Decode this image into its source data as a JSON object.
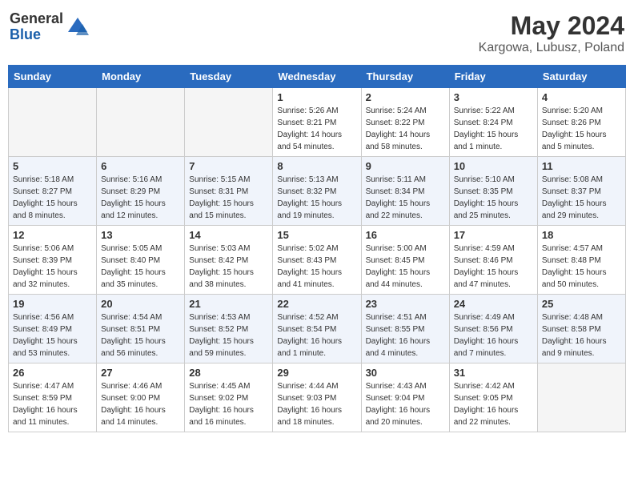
{
  "logo": {
    "general": "General",
    "blue": "Blue"
  },
  "header": {
    "title": "May 2024",
    "subtitle": "Kargowa, Lubusz, Poland"
  },
  "weekdays": [
    "Sunday",
    "Monday",
    "Tuesday",
    "Wednesday",
    "Thursday",
    "Friday",
    "Saturday"
  ],
  "weeks": [
    [
      {
        "day": "",
        "info": ""
      },
      {
        "day": "",
        "info": ""
      },
      {
        "day": "",
        "info": ""
      },
      {
        "day": "1",
        "info": "Sunrise: 5:26 AM\nSunset: 8:21 PM\nDaylight: 14 hours\nand 54 minutes."
      },
      {
        "day": "2",
        "info": "Sunrise: 5:24 AM\nSunset: 8:22 PM\nDaylight: 14 hours\nand 58 minutes."
      },
      {
        "day": "3",
        "info": "Sunrise: 5:22 AM\nSunset: 8:24 PM\nDaylight: 15 hours\nand 1 minute."
      },
      {
        "day": "4",
        "info": "Sunrise: 5:20 AM\nSunset: 8:26 PM\nDaylight: 15 hours\nand 5 minutes."
      }
    ],
    [
      {
        "day": "5",
        "info": "Sunrise: 5:18 AM\nSunset: 8:27 PM\nDaylight: 15 hours\nand 8 minutes."
      },
      {
        "day": "6",
        "info": "Sunrise: 5:16 AM\nSunset: 8:29 PM\nDaylight: 15 hours\nand 12 minutes."
      },
      {
        "day": "7",
        "info": "Sunrise: 5:15 AM\nSunset: 8:31 PM\nDaylight: 15 hours\nand 15 minutes."
      },
      {
        "day": "8",
        "info": "Sunrise: 5:13 AM\nSunset: 8:32 PM\nDaylight: 15 hours\nand 19 minutes."
      },
      {
        "day": "9",
        "info": "Sunrise: 5:11 AM\nSunset: 8:34 PM\nDaylight: 15 hours\nand 22 minutes."
      },
      {
        "day": "10",
        "info": "Sunrise: 5:10 AM\nSunset: 8:35 PM\nDaylight: 15 hours\nand 25 minutes."
      },
      {
        "day": "11",
        "info": "Sunrise: 5:08 AM\nSunset: 8:37 PM\nDaylight: 15 hours\nand 29 minutes."
      }
    ],
    [
      {
        "day": "12",
        "info": "Sunrise: 5:06 AM\nSunset: 8:39 PM\nDaylight: 15 hours\nand 32 minutes."
      },
      {
        "day": "13",
        "info": "Sunrise: 5:05 AM\nSunset: 8:40 PM\nDaylight: 15 hours\nand 35 minutes."
      },
      {
        "day": "14",
        "info": "Sunrise: 5:03 AM\nSunset: 8:42 PM\nDaylight: 15 hours\nand 38 minutes."
      },
      {
        "day": "15",
        "info": "Sunrise: 5:02 AM\nSunset: 8:43 PM\nDaylight: 15 hours\nand 41 minutes."
      },
      {
        "day": "16",
        "info": "Sunrise: 5:00 AM\nSunset: 8:45 PM\nDaylight: 15 hours\nand 44 minutes."
      },
      {
        "day": "17",
        "info": "Sunrise: 4:59 AM\nSunset: 8:46 PM\nDaylight: 15 hours\nand 47 minutes."
      },
      {
        "day": "18",
        "info": "Sunrise: 4:57 AM\nSunset: 8:48 PM\nDaylight: 15 hours\nand 50 minutes."
      }
    ],
    [
      {
        "day": "19",
        "info": "Sunrise: 4:56 AM\nSunset: 8:49 PM\nDaylight: 15 hours\nand 53 minutes."
      },
      {
        "day": "20",
        "info": "Sunrise: 4:54 AM\nSunset: 8:51 PM\nDaylight: 15 hours\nand 56 minutes."
      },
      {
        "day": "21",
        "info": "Sunrise: 4:53 AM\nSunset: 8:52 PM\nDaylight: 15 hours\nand 59 minutes."
      },
      {
        "day": "22",
        "info": "Sunrise: 4:52 AM\nSunset: 8:54 PM\nDaylight: 16 hours\nand 1 minute."
      },
      {
        "day": "23",
        "info": "Sunrise: 4:51 AM\nSunset: 8:55 PM\nDaylight: 16 hours\nand 4 minutes."
      },
      {
        "day": "24",
        "info": "Sunrise: 4:49 AM\nSunset: 8:56 PM\nDaylight: 16 hours\nand 7 minutes."
      },
      {
        "day": "25",
        "info": "Sunrise: 4:48 AM\nSunset: 8:58 PM\nDaylight: 16 hours\nand 9 minutes."
      }
    ],
    [
      {
        "day": "26",
        "info": "Sunrise: 4:47 AM\nSunset: 8:59 PM\nDaylight: 16 hours\nand 11 minutes."
      },
      {
        "day": "27",
        "info": "Sunrise: 4:46 AM\nSunset: 9:00 PM\nDaylight: 16 hours\nand 14 minutes."
      },
      {
        "day": "28",
        "info": "Sunrise: 4:45 AM\nSunset: 9:02 PM\nDaylight: 16 hours\nand 16 minutes."
      },
      {
        "day": "29",
        "info": "Sunrise: 4:44 AM\nSunset: 9:03 PM\nDaylight: 16 hours\nand 18 minutes."
      },
      {
        "day": "30",
        "info": "Sunrise: 4:43 AM\nSunset: 9:04 PM\nDaylight: 16 hours\nand 20 minutes."
      },
      {
        "day": "31",
        "info": "Sunrise: 4:42 AM\nSunset: 9:05 PM\nDaylight: 16 hours\nand 22 minutes."
      },
      {
        "day": "",
        "info": ""
      }
    ]
  ]
}
